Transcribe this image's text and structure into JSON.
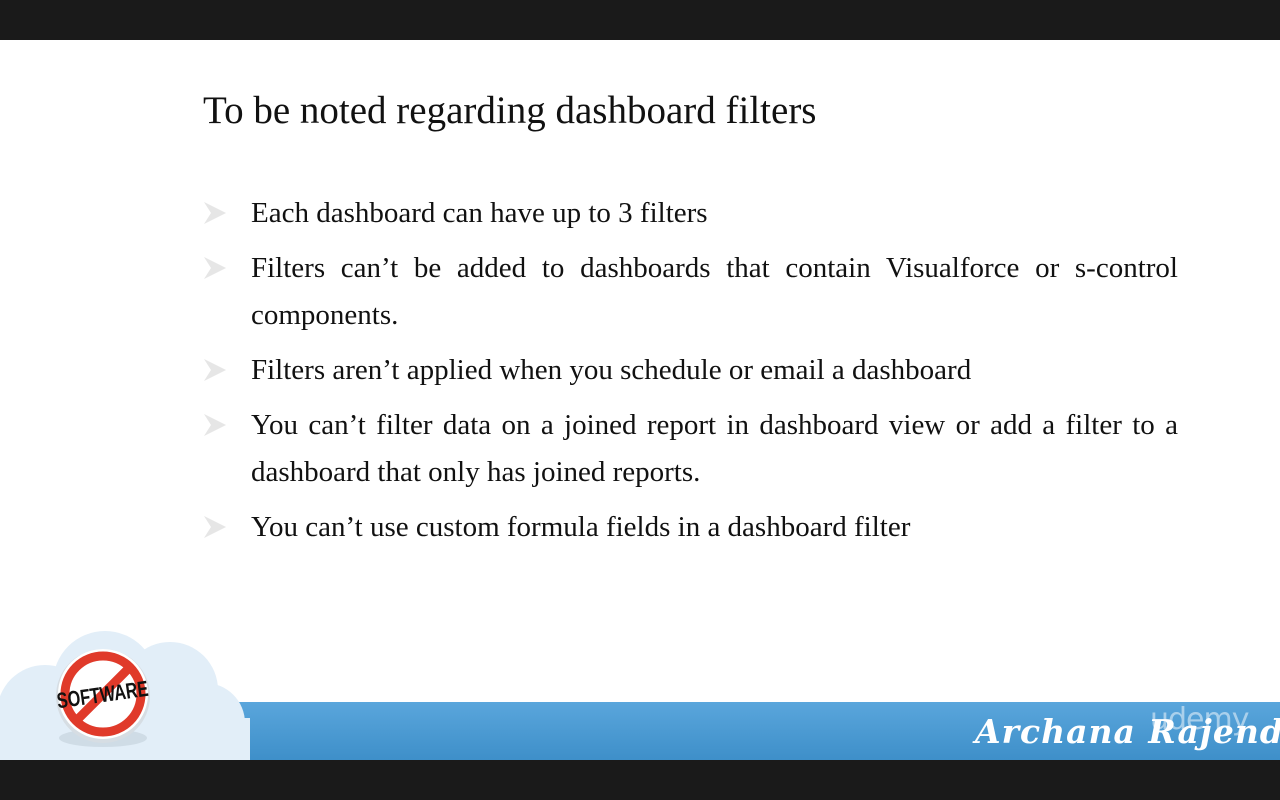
{
  "slide": {
    "title": "To be noted regarding dashboard filters",
    "bullets": [
      "Each dashboard can have up to 3 filters",
      "Filters can’t be added to dashboards that contain Visualforce or s-control components.",
      "Filters aren’t applied when you schedule or email a dashboard",
      "You can’t filter data on a joined report in dashboard view or add a filter to a dashboard that only has joined reports.",
      "You can’t use custom formula fields in a dashboard filter"
    ]
  },
  "branding": {
    "logo_text": "SOFTWARE",
    "signature": "Archana Rajendran",
    "watermark": "udemy"
  },
  "colors": {
    "band": "#4a9ad4",
    "cloud": "#e2eef8",
    "no_sign": "#e03a2a"
  },
  "icons": {
    "bullet": "arrow-bullet-icon",
    "logo": "no-software-logo-icon"
  }
}
